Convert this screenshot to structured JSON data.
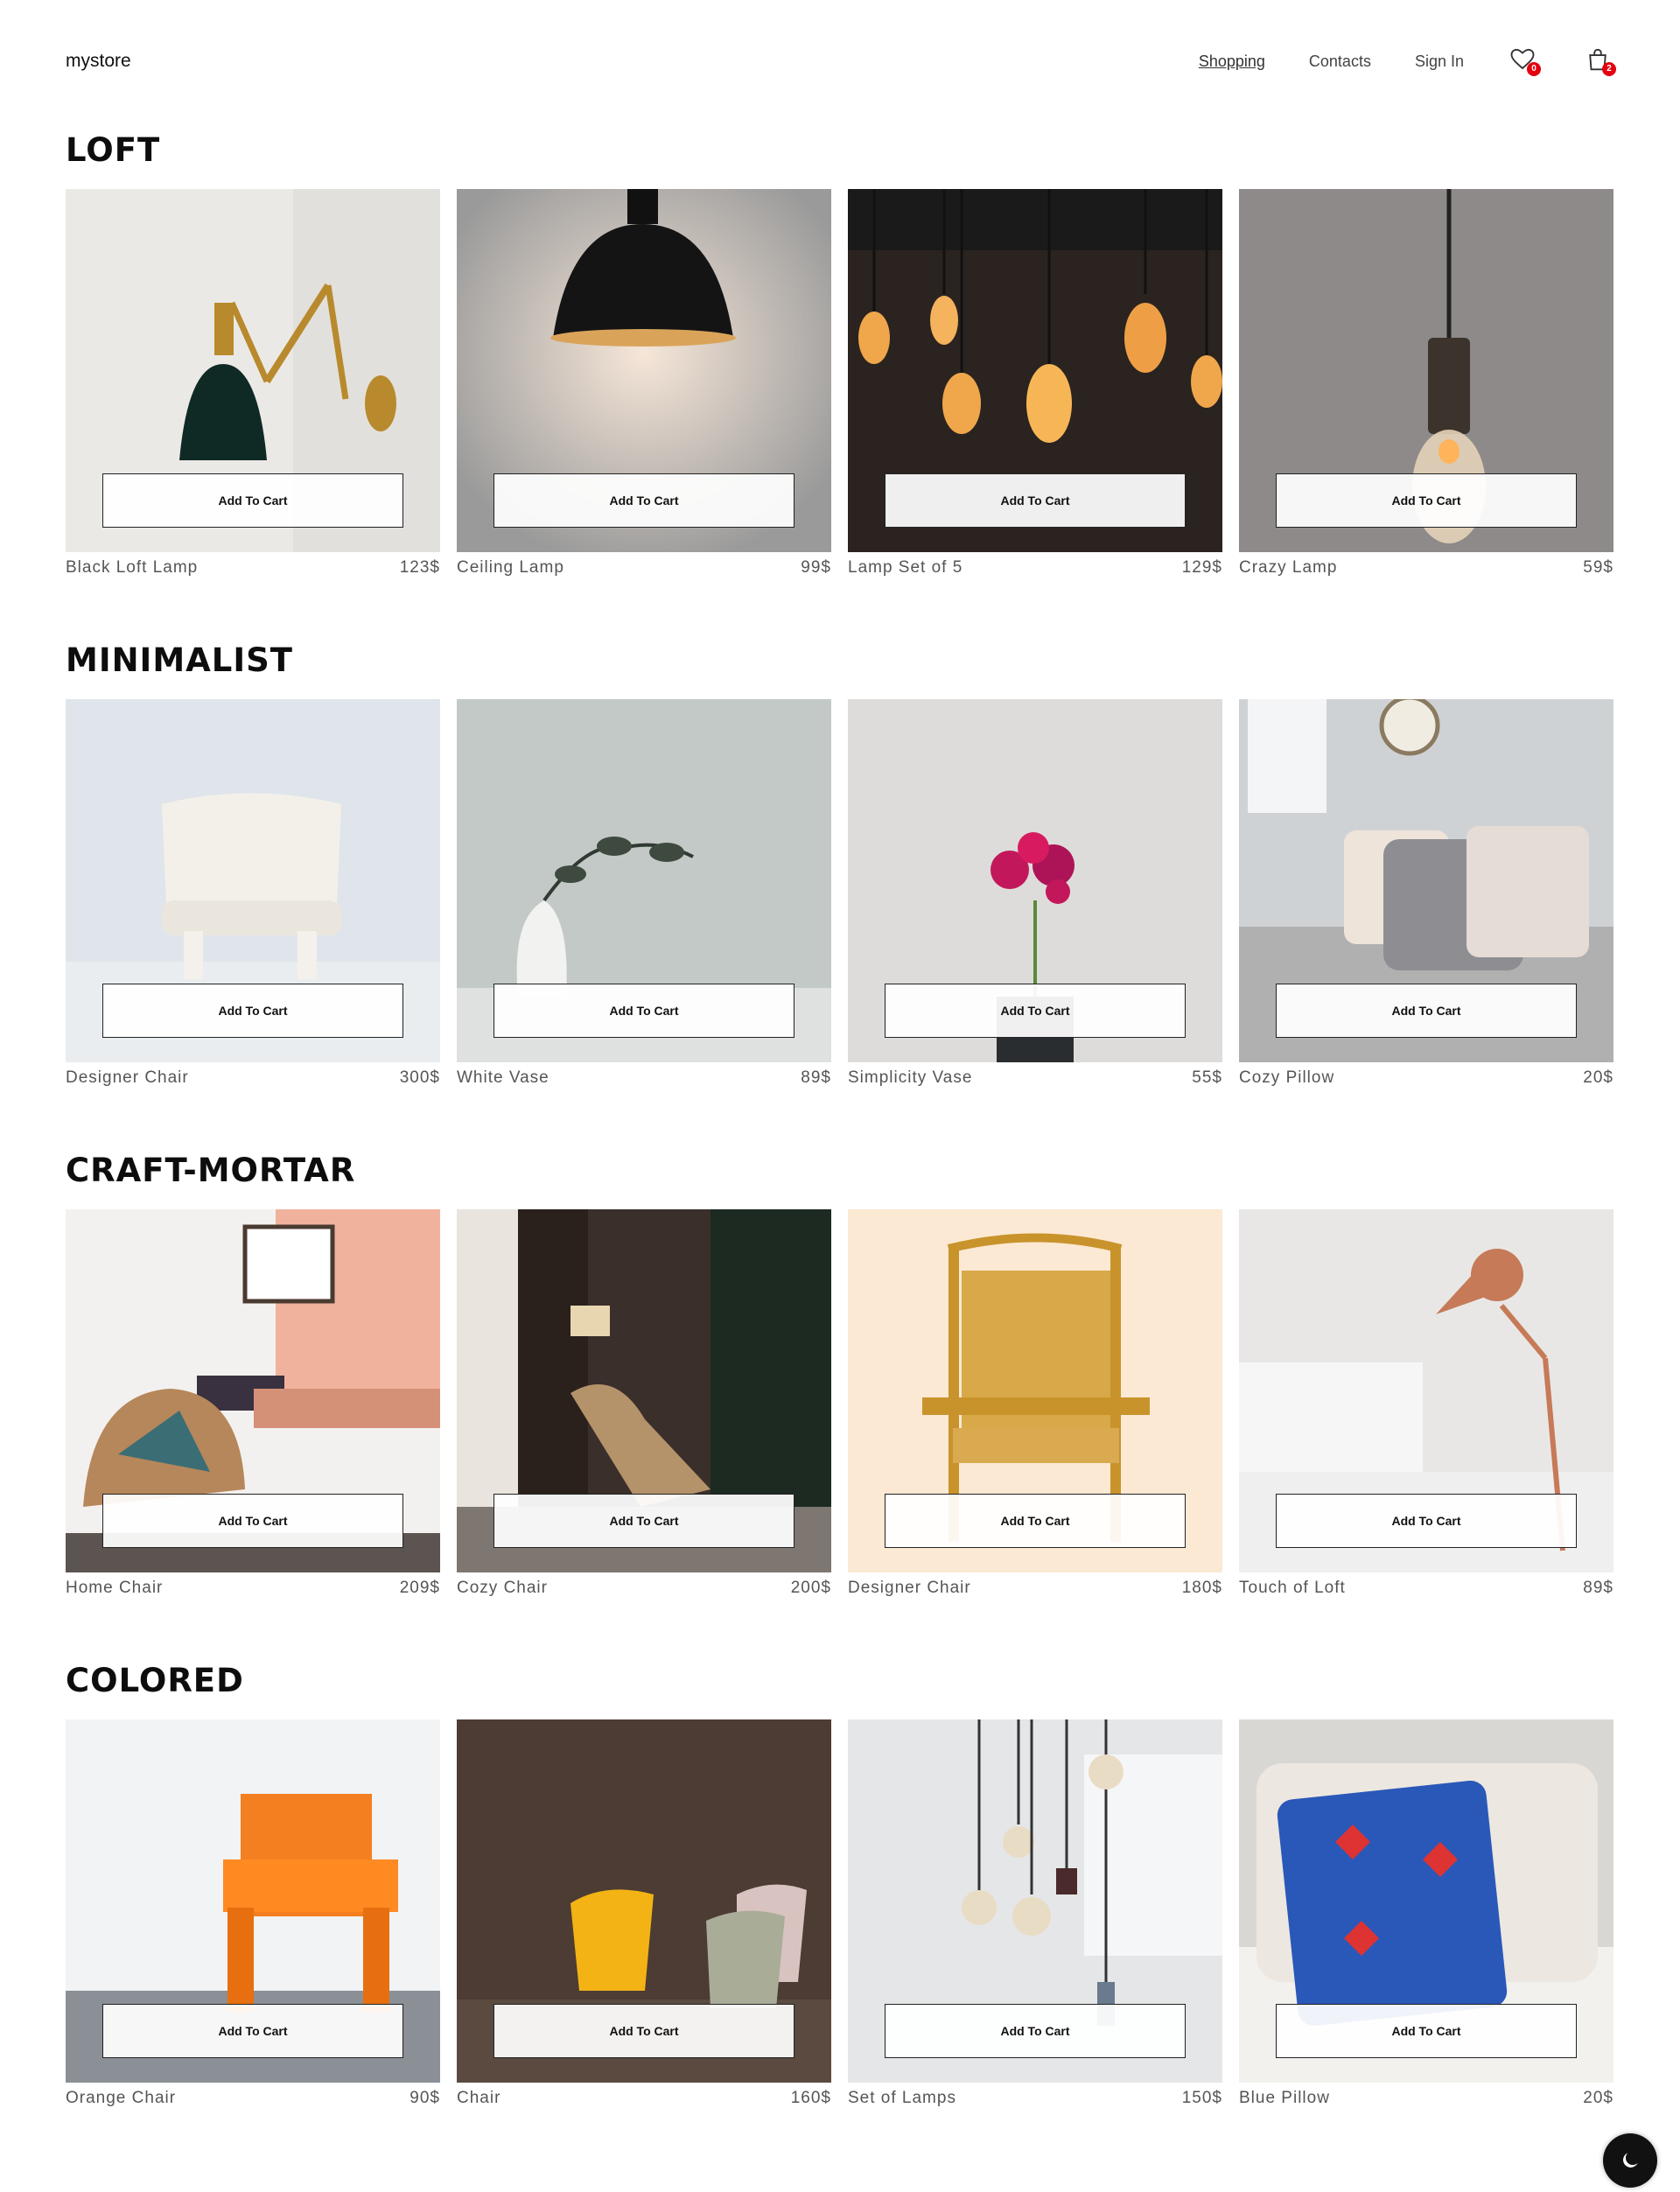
{
  "header": {
    "logo": "mystore",
    "nav": [
      "Shopping",
      "Contacts",
      "Sign In"
    ],
    "wishlist_count": "0",
    "cart_count": "2"
  },
  "sections": [
    {
      "title": "LOFT",
      "products": [
        {
          "name": "Black Loft Lamp",
          "price": "123$",
          "button": "Add To Cart"
        },
        {
          "name": "Ceiling Lamp",
          "price": "99$",
          "button": "Add To Cart"
        },
        {
          "name": "Lamp Set of 5",
          "price": "129$",
          "button": "Add To Cart"
        },
        {
          "name": "Crazy Lamp",
          "price": "59$",
          "button": "Add To Cart"
        }
      ]
    },
    {
      "title": "MINIMALIST",
      "products": [
        {
          "name": "Designer Chair",
          "price": "300$",
          "button": "Add To Cart"
        },
        {
          "name": "White Vase",
          "price": "89$",
          "button": "Add To Cart"
        },
        {
          "name": "Simplicity Vase",
          "price": "55$",
          "button": "Add To Cart"
        },
        {
          "name": "Cozy Pillow",
          "price": "20$",
          "button": "Add To Cart"
        }
      ]
    },
    {
      "title": "CRAFT-MORTAR",
      "products": [
        {
          "name": "Home Chair",
          "price": "209$",
          "button": "Add To Cart"
        },
        {
          "name": "Cozy Chair",
          "price": "200$",
          "button": "Add To Cart"
        },
        {
          "name": "Designer Chair",
          "price": "180$",
          "button": "Add To Cart"
        },
        {
          "name": "Touch of Loft",
          "price": "89$",
          "button": "Add To Cart"
        }
      ]
    },
    {
      "title": "COLORED",
      "products": [
        {
          "name": "Orange Chair",
          "price": "90$",
          "button": "Add To Cart"
        },
        {
          "name": "Chair",
          "price": "160$",
          "button": "Add To Cart"
        },
        {
          "name": "Set of Lamps",
          "price": "150$",
          "button": "Add To Cart"
        },
        {
          "name": "Blue Pillow",
          "price": "20$",
          "button": "Add To Cart"
        }
      ]
    }
  ],
  "icons": {
    "wishlist": "heart-icon",
    "cart": "shopping-bag-icon",
    "theme": "moon-icon"
  }
}
